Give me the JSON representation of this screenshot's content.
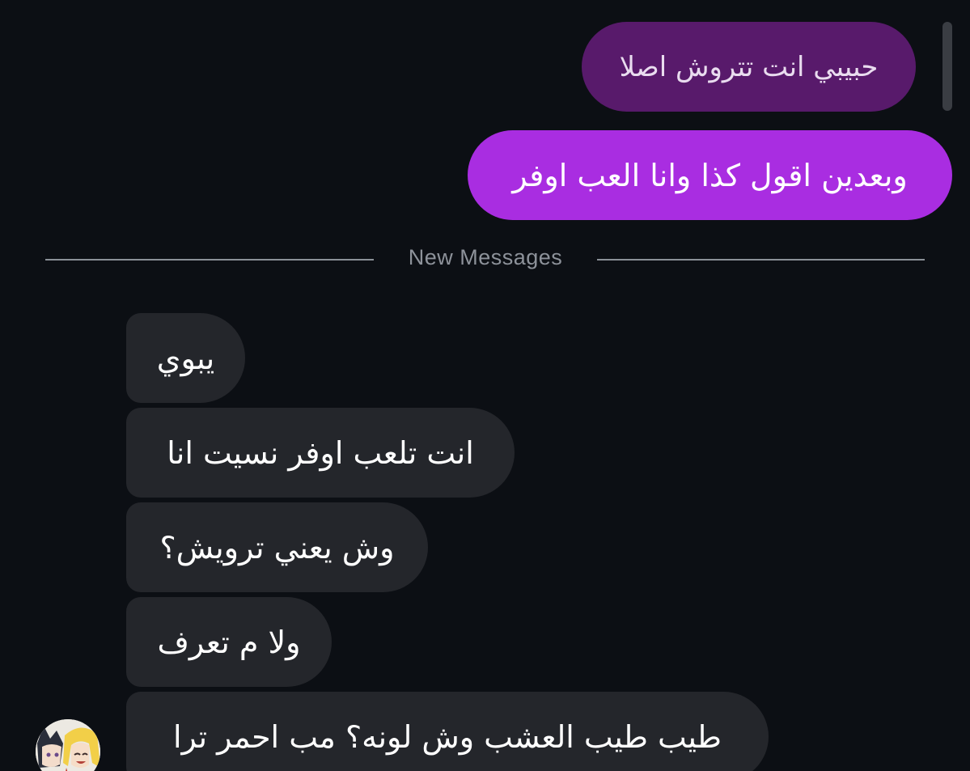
{
  "chat": {
    "sent_messages": [
      "حبيبي انت تتروش اصلا",
      "وبعدين اقول كذا وانا العب اوفر"
    ],
    "divider_label": "New Messages",
    "received_messages": [
      "يبوي",
      "انت تلعب اوفر نسيت انا",
      "وش يعني ترويش؟",
      "ولا م تعرف",
      "طيب طيب العشب وش لونه؟ مب احمر ترا"
    ],
    "sender_avatar_icon": "anime-avatar-icon"
  },
  "colors": {
    "background": "#0c0f14",
    "sent_bubble_dark": "#581a6b",
    "sent_bubble_bright": "#a92de1",
    "received_bubble": "#24262b",
    "divider": "#8b9097"
  }
}
